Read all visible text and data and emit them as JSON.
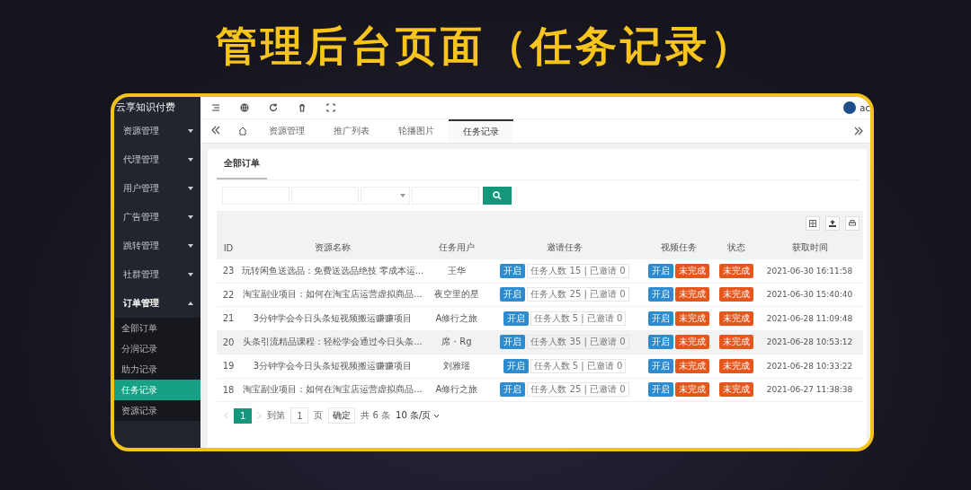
{
  "title": "管理后台页面（任务记录）",
  "sidebar": {
    "brand": "云享知识付费",
    "items": [
      {
        "label": "资源管理",
        "expanded": false
      },
      {
        "label": "代理管理",
        "expanded": false
      },
      {
        "label": "用户管理",
        "expanded": false
      },
      {
        "label": "广告管理",
        "expanded": false
      },
      {
        "label": "跳转管理",
        "expanded": false
      },
      {
        "label": "社群管理",
        "expanded": false
      },
      {
        "label": "订单管理",
        "expanded": true,
        "children": [
          {
            "label": "全部订单",
            "selected": false
          },
          {
            "label": "分润记录",
            "selected": false
          },
          {
            "label": "助力记录",
            "selected": false
          },
          {
            "label": "任务记录",
            "selected": true
          },
          {
            "label": "资源记录",
            "selected": false
          }
        ]
      }
    ]
  },
  "header": {
    "user_name": "ac"
  },
  "tabs": [
    {
      "label": "资源管理",
      "selected": false
    },
    {
      "label": "推广列表",
      "selected": false
    },
    {
      "label": "轮播图片",
      "selected": false
    },
    {
      "label": "任务记录",
      "selected": true
    }
  ],
  "card": {
    "subtabs": [
      {
        "label": "全部订单",
        "selected": true
      }
    ],
    "filters": [
      {
        "kind": "input"
      },
      {
        "kind": "input"
      },
      {
        "kind": "select"
      },
      {
        "kind": "input"
      }
    ]
  },
  "table": {
    "columns": [
      "ID",
      "资源名称",
      "任务用户",
      "邀请任务",
      "视频任务",
      "状态",
      "获取时间"
    ],
    "rows": [
      {
        "id": "23",
        "resource": "玩转闲鱼送选品：免费送选品绝技 零成本运...",
        "user": "王华",
        "invite": {
          "tag": {
            "label": "开启",
            "kind": "primary"
          },
          "text": "任务人数 15 | 已邀请 0"
        },
        "video": [
          {
            "label": "开启",
            "kind": "primary"
          },
          {
            "label": "未完成",
            "kind": "warning"
          }
        ],
        "status": {
          "label": "未完成",
          "kind": "warning"
        },
        "time": "2021-06-30 16:11:58",
        "highlighted": false
      },
      {
        "id": "22",
        "resource": "淘宝副业项目：如何在淘宝店运营虚拟商品...",
        "user": "夜空里的星",
        "invite": {
          "tag": {
            "label": "开启",
            "kind": "primary"
          },
          "text": "任务人数 25 | 已邀请 0"
        },
        "video": [
          {
            "label": "开启",
            "kind": "primary"
          },
          {
            "label": "未完成",
            "kind": "warning"
          }
        ],
        "status": {
          "label": "未完成",
          "kind": "warning"
        },
        "time": "2021-06-30 15:40:40",
        "highlighted": false
      },
      {
        "id": "21",
        "resource": "3分钟学会今日头条短视频搬运赚赚项目",
        "user": "A修行之旅",
        "invite": {
          "tag": {
            "label": "开启",
            "kind": "primary"
          },
          "text": "任务人数 5 | 已邀请 0"
        },
        "video": [
          {
            "label": "开启",
            "kind": "primary"
          },
          {
            "label": "未完成",
            "kind": "warning"
          }
        ],
        "status": {
          "label": "未完成",
          "kind": "warning"
        },
        "time": "2021-06-28 11:09:48",
        "highlighted": false
      },
      {
        "id": "20",
        "resource": "头条引流精品课程：轻松学会通过今日头条...",
        "user": "席・Rg",
        "invite": {
          "tag": {
            "label": "开启",
            "kind": "primary"
          },
          "text": "任务人数 35 | 已邀请 0"
        },
        "video": [
          {
            "label": "开启",
            "kind": "primary"
          },
          {
            "label": "未完成",
            "kind": "warning"
          }
        ],
        "status": {
          "label": "未完成",
          "kind": "warning"
        },
        "time": "2021-06-28 10:53:12",
        "highlighted": true
      },
      {
        "id": "19",
        "resource": "3分钟学会今日头条短视频搬运赚赚项目",
        "user": "刘雅瑶",
        "invite": {
          "tag": {
            "label": "开启",
            "kind": "primary"
          },
          "text": "任务人数 5 | 已邀请 0"
        },
        "video": [
          {
            "label": "开启",
            "kind": "primary"
          },
          {
            "label": "未完成",
            "kind": "warning"
          }
        ],
        "status": {
          "label": "未完成",
          "kind": "warning"
        },
        "time": "2021-06-28 10:33:22",
        "highlighted": false
      },
      {
        "id": "18",
        "resource": "淘宝副业项目：如何在淘宝店运营虚拟商品...",
        "user": "A修行之旅",
        "invite": {
          "tag": {
            "label": "开启",
            "kind": "primary"
          },
          "text": "任务人数 25 | 已邀请 0"
        },
        "video": [
          {
            "label": "开启",
            "kind": "primary"
          },
          {
            "label": "未完成",
            "kind": "warning"
          }
        ],
        "status": {
          "label": "未完成",
          "kind": "warning"
        },
        "time": "2021-06-27 11:38:38",
        "highlighted": false
      }
    ]
  },
  "pagination": {
    "pages": [
      {
        "label": "1",
        "selected": true
      }
    ],
    "goto_label": "到第",
    "goto_value": "1",
    "page_unit": "页",
    "confirm": "确定",
    "total": "共 6 条",
    "page_size": "10 条/页"
  }
}
